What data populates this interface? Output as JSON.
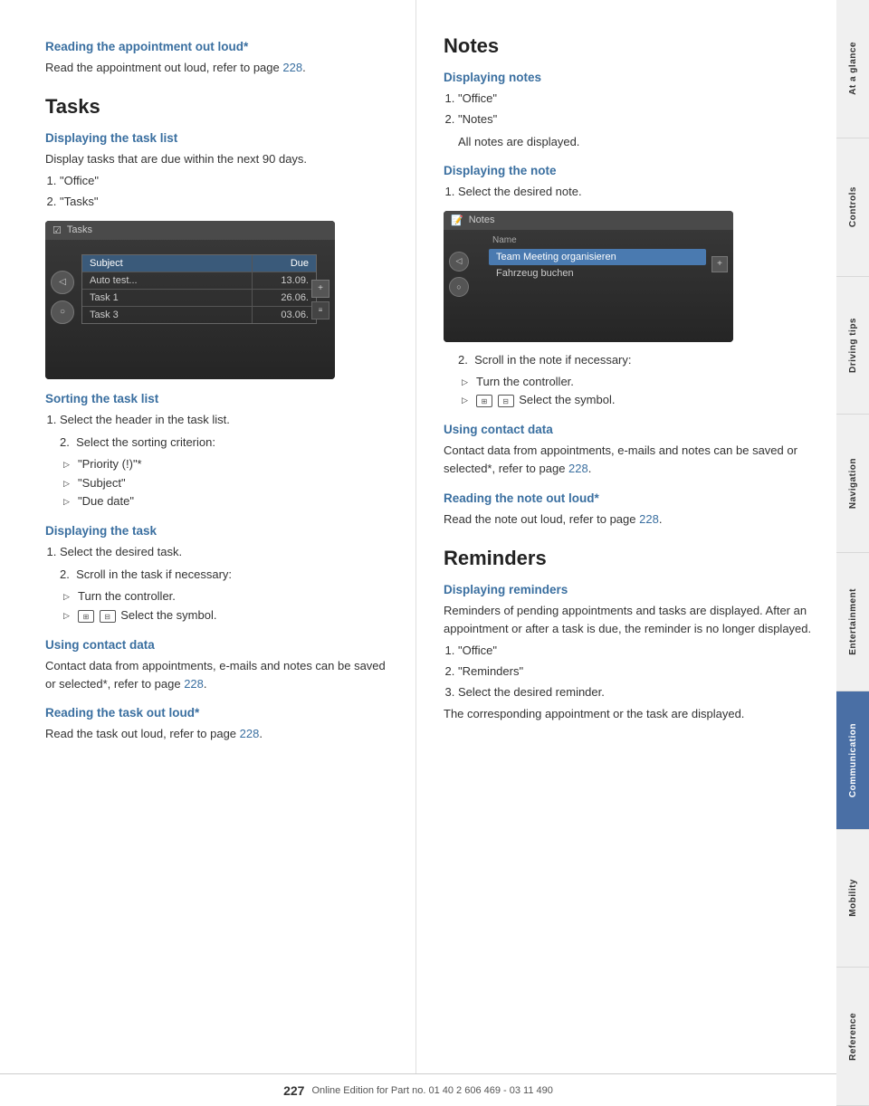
{
  "left": {
    "top_section": {
      "title": "Reading the appointment out loud*",
      "body": "Read the appointment out loud, refer to page",
      "link": "228",
      "link_suffix": "."
    },
    "tasks_section": {
      "title": "Tasks",
      "subsections": [
        {
          "id": "displaying-task-list",
          "title": "Displaying the task list",
          "body": "Display tasks that are due within the next 90 days.",
          "numbered": [
            "\"Office\"",
            "\"Tasks\""
          ],
          "has_screen": true,
          "screen": {
            "title": "Tasks",
            "header": [
              "Subject",
              "Due"
            ],
            "rows": [
              {
                "subject": "Auto test...",
                "due": "13.09."
              },
              {
                "subject": "Task 1",
                "due": "26.06."
              },
              {
                "subject": "Task 3",
                "due": "03.06."
              }
            ]
          }
        },
        {
          "id": "sorting-task-list",
          "title": "Sorting the task list",
          "numbered": [
            "Select the header in the task list."
          ],
          "numbered2_label": "2.",
          "numbered2_body": "Select the sorting criterion:",
          "bullets": [
            "\"Priority (!)\"*",
            "\"Subject\"",
            "\"Due date\""
          ]
        },
        {
          "id": "displaying-task",
          "title": "Displaying the task",
          "numbered": [
            "Select the desired task."
          ],
          "numbered2_label": "2.",
          "numbered2_body": "Scroll in the task if necessary:",
          "bullets2": [
            "Turn the controller.",
            "Select the symbol."
          ]
        },
        {
          "id": "using-contact-data-left",
          "title": "Using contact data",
          "body": "Contact data from appointments, e-mails and notes can be saved or selected*, refer to page",
          "link": "228",
          "link_suffix": "."
        },
        {
          "id": "reading-task-loud",
          "title": "Reading the task out loud*",
          "body": "Read the task out loud, refer to page",
          "link": "228",
          "link_suffix": "."
        }
      ]
    }
  },
  "right": {
    "notes_section": {
      "title": "Notes",
      "subsections": [
        {
          "id": "displaying-notes",
          "title": "Displaying notes",
          "numbered": [
            "\"Office\"",
            "\"Notes\""
          ],
          "body_after": "All notes are displayed."
        },
        {
          "id": "displaying-note",
          "title": "Displaying the note",
          "numbered": [
            "Select the desired note."
          ],
          "has_screen": true,
          "screen": {
            "title": "Notes",
            "label": "Name",
            "items": [
              {
                "text": "Team Meeting organisieren",
                "selected": true
              },
              {
                "text": "Fahrzeug buchen",
                "selected": false
              }
            ]
          },
          "numbered2_label": "2.",
          "numbered2_body": "Scroll in the note if necessary:",
          "bullets": [
            "Turn the controller.",
            "Select the symbol."
          ]
        },
        {
          "id": "using-contact-data-right",
          "title": "Using contact data",
          "body": "Contact data from appointments, e-mails and notes can be saved or selected*, refer to page",
          "link": "228",
          "link_suffix": "."
        },
        {
          "id": "reading-note-loud",
          "title": "Reading the note out loud*",
          "body": "Read the note out loud, refer to page",
          "link": "228",
          "link_suffix": "."
        }
      ]
    },
    "reminders_section": {
      "title": "Reminders",
      "subsections": [
        {
          "id": "displaying-reminders",
          "title": "Displaying reminders",
          "body": "Reminders of pending appointments and tasks are displayed. After an appointment or after a task is due, the reminder is no longer displayed.",
          "numbered": [
            "\"Office\"",
            "\"Reminders\"",
            "Select the desired reminder."
          ],
          "body_after": "The corresponding appointment or the task are displayed."
        }
      ]
    }
  },
  "sidebar": {
    "items": [
      {
        "label": "At a glance",
        "active": false
      },
      {
        "label": "Controls",
        "active": false
      },
      {
        "label": "Driving tips",
        "active": false
      },
      {
        "label": "Navigation",
        "active": false
      },
      {
        "label": "Entertainment",
        "active": false
      },
      {
        "label": "Communication",
        "active": true
      },
      {
        "label": "Mobility",
        "active": false
      },
      {
        "label": "Reference",
        "active": false
      }
    ]
  },
  "footer": {
    "page_number": "227",
    "text": "Online Edition for Part no. 01 40 2 606 469 - 03 11 490"
  }
}
